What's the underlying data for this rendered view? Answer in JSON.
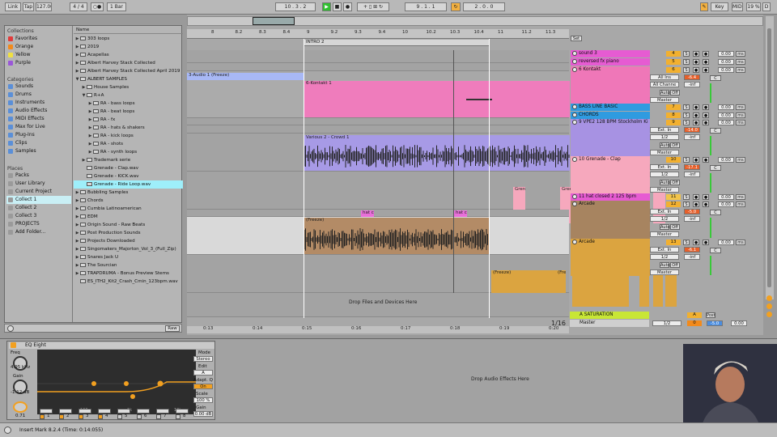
{
  "topbar": {
    "link": "Link",
    "tap": "Tap",
    "tempo": "127.00",
    "sig": "4 / 4",
    "loop_mode": "1 Bar",
    "position": "10 .  3 .  2",
    "loop_start": "9 .  1 .  1",
    "loop_len": "2 .  0 .  0",
    "key": "Key",
    "midi": "MIDI",
    "cpu": "19 %",
    "d": "D"
  },
  "collections": {
    "title": "Collections",
    "items": [
      {
        "label": "Favorites",
        "color": "#e23b3b"
      },
      {
        "label": "Orange",
        "color": "#f28a1c"
      },
      {
        "label": "Yellow",
        "color": "#f0e040"
      },
      {
        "label": "Purple",
        "color": "#9a57d8"
      }
    ]
  },
  "categories": {
    "title": "Categories",
    "items": [
      "Sounds",
      "Drums",
      "Instruments",
      "Audio Effects",
      "MIDI Effects",
      "Max for Live",
      "Plug-Ins",
      "Clips",
      "Samples"
    ]
  },
  "places": {
    "title": "Places",
    "items": [
      "Packs",
      "User Library",
      "Current Project",
      "Collect 1",
      "Collect 2",
      "Collect 3",
      "PROJECTS",
      "Add Folder..."
    ]
  },
  "files": {
    "header": "Name",
    "rows": [
      "303 loops",
      "2019",
      "Acapellas",
      "Albert Harvey Stack Collected",
      "Albert Harvey Stack Collected April 2019",
      "ALBERT SAMPLES",
      "House Samples",
      "R+A",
      "RA - bass loops",
      "RA - beat loops",
      "RA - fx",
      "RA - hats & shakers",
      "RA - kick loops",
      "RA - shots",
      "RA - synth loops",
      "Trademark serie",
      "Grenade - Clap.wav",
      "Grenade - KICK.wav",
      "Grenade - Ride Loop.wav",
      "Bubbling Samples",
      "Chords",
      "Cumbia Latinoamerican",
      "EDM",
      "Origin Sound - Raw Beats",
      "Post Production Sounds",
      "Projects Downloaded",
      "Singomakers_Majorton_Vol_3_(Full_Zip)",
      "Snares Jack U",
      "The Sourcian",
      "TRAPDRUMA - Bonus Preview Stems",
      "ES_ITH2_Kit2_Crash_Cmin_123bpm.wav"
    ],
    "raw": "Raw"
  },
  "ruler": {
    "ticks": [
      "8",
      "8.2",
      "8.3",
      "8.4",
      "9",
      "9.2",
      "9.3",
      "9.4",
      "10",
      "10.2",
      "10.3",
      "10.4",
      "11",
      "11.2",
      "11.3"
    ],
    "locator": "INTRO 2",
    "set": "Set"
  },
  "clips": {
    "audio1": "3-Audio 1 (Freeze)",
    "kontakt": "6-Kontakt 1",
    "crowd": "Various 2 - Crowd 1",
    "grenade": "Grena",
    "hat": "hat c",
    "freeze": "(Freeze)",
    "fre": "(Fre"
  },
  "tracks": [
    {
      "name": "sound 3",
      "num": "4",
      "color": "#e65bd2",
      "input": "",
      "vol": "0.00"
    },
    {
      "name": "reversed fx piano",
      "num": "5",
      "color": "#e65bd2",
      "input": "",
      "vol": "0.00"
    },
    {
      "name": "6 Kontakt",
      "num": "6",
      "color": "#ef77b8",
      "input": "All Ins",
      "input2": "All Channe",
      "vol": "0.00",
      "v2": "-6.4",
      "inf": "-inf"
    },
    {
      "name": "BASS LINE BASIC",
      "num": "7",
      "color": "#2f9be0",
      "vol": "0.00"
    },
    {
      "name": "CHORDS",
      "num": "8",
      "color": "#2f9be0",
      "vol": "0.00"
    },
    {
      "name": "9 VPE2 128 BPM Stockholm Ki",
      "num": "9",
      "color": "#a792e3",
      "input": "Ext. In",
      "input2": "1/2",
      "vol": "0.00",
      "v2": "-14.0",
      "inf": "-inf"
    },
    {
      "name": "10 Grenade - Clap",
      "num": "10",
      "color": "#f6a8bd",
      "input": "Ext. In",
      "input2": "1/2",
      "vol": "0.00",
      "v2": "-17.1",
      "inf": "-inf"
    },
    {
      "name": "11 hat closed 2 125 bpm",
      "num": "11",
      "color": "#e65bd2",
      "vol": "0.00"
    },
    {
      "name": "Arcade",
      "num": "12",
      "color": "#a78460",
      "input": "Ext. In",
      "input2": "1/2",
      "vol": "0.00",
      "v2": "-5.0",
      "inf": "-inf"
    },
    {
      "name": "Arcade",
      "num": "13",
      "color": "#dba440",
      "input": "Ext. In",
      "input2": "1/2",
      "vol": "0.00",
      "v2": "-6.1",
      "inf": "-inf"
    }
  ],
  "returns": {
    "sat": "A SATURATION",
    "sat_num": "A",
    "post": "Post",
    "master": "Master",
    "master_num": "0",
    "master_sel": "1/2",
    "master_vol": "0.00",
    "master_val": "-5.0"
  },
  "monitor": "Master",
  "auto": "Auto",
  "off": "Off",
  "ms": "ms",
  "drop_arr": "Drop Files and Devices Here",
  "time_ticks": [
    "0:13",
    "0:14",
    "0:15",
    "0:16",
    "0:17",
    "0:18",
    "0:19",
    "0:20"
  ],
  "zoom": "1/16",
  "eq": {
    "name": "EQ Eight",
    "freq_label": "Freq",
    "freq": "4.95 kHz",
    "gain_label": "Gain",
    "gain": "-1.12 dB",
    "q": "0.71",
    "mode_label": "Mode",
    "mode": "Stereo",
    "edit_label": "Edit",
    "edit": "A",
    "adapt_label": "Adapt. Q",
    "adapt": "On",
    "scale_label": "Scale",
    "scale": "100 %",
    "gain2_label": "Gain",
    "gain2": "0.00 dB",
    "bands": [
      "1",
      "2",
      "3",
      "4",
      "5",
      "6",
      "7",
      "8"
    ],
    "axis": [
      "100",
      "1k",
      "10k"
    ]
  },
  "drop_fx": "Drop Audio Effects Here",
  "status": "Insert Mark 8.2.4 (Time: 0:14:055)"
}
